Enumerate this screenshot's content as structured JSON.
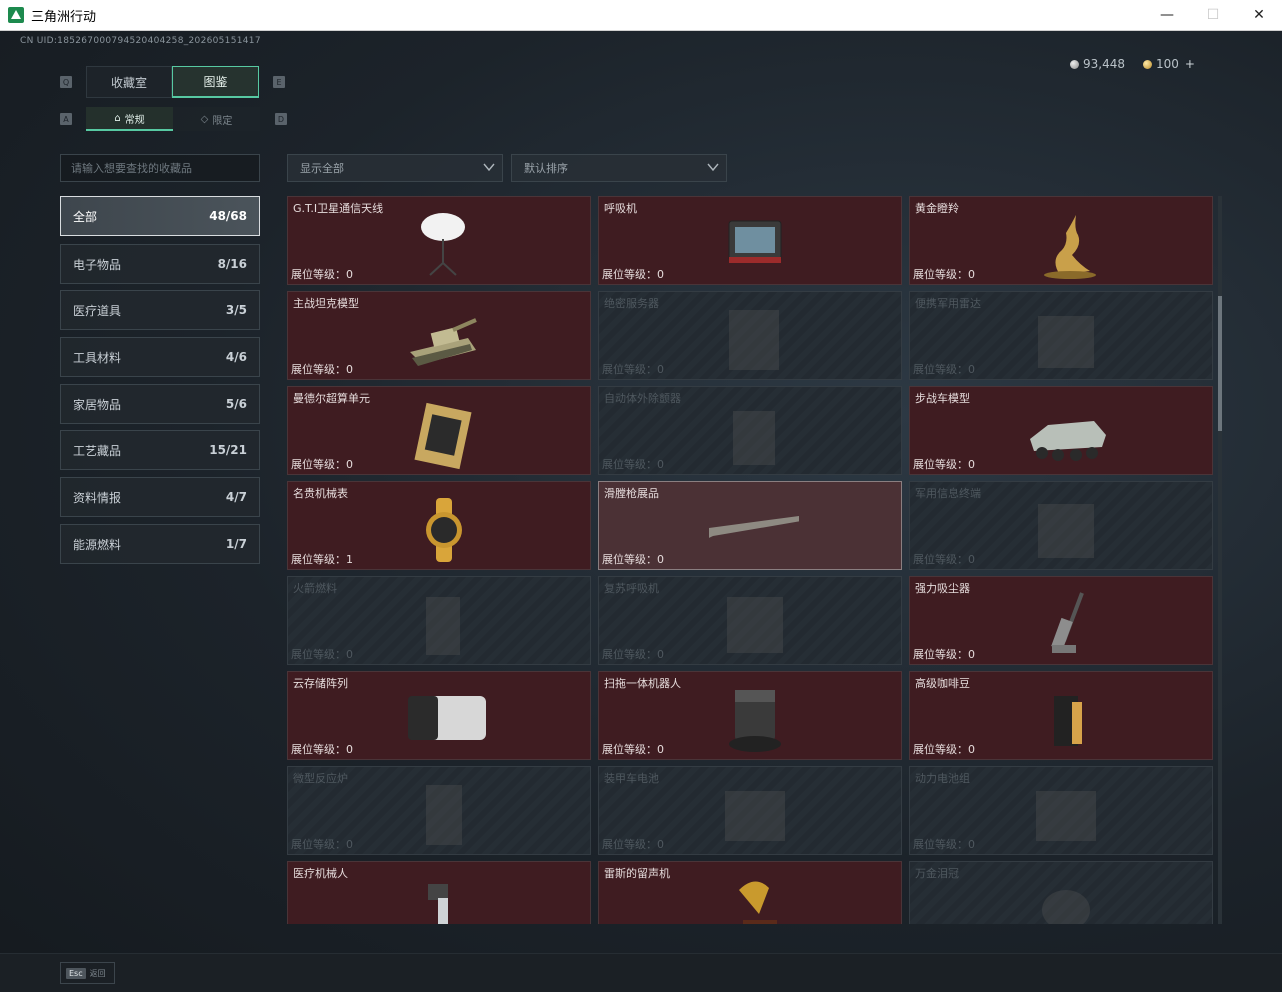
{
  "window": {
    "title": "三角洲行动",
    "minimize": "—",
    "maximize": "☐",
    "close": "✕"
  },
  "uid": "CN UID:185267000794520404258_202605151417",
  "currency": {
    "silver": "93,448",
    "gold": "100",
    "plus": "+"
  },
  "key_hints": {
    "q": "Q",
    "e": "E",
    "a": "A",
    "d": "D"
  },
  "tabs": [
    {
      "label": "收藏室"
    },
    {
      "label": "图鉴"
    }
  ],
  "subtabs": [
    {
      "label": "常规"
    },
    {
      "label": "限定"
    }
  ],
  "search": {
    "placeholder": "请输入想要查找的收藏品"
  },
  "filters": {
    "show": "显示全部",
    "sort": "默认排序"
  },
  "categories": [
    {
      "label": "全部",
      "count": "48/68"
    },
    {
      "label": "电子物品",
      "count": "8/16"
    },
    {
      "label": "医疗道具",
      "count": "3/5"
    },
    {
      "label": "工具材料",
      "count": "4/6"
    },
    {
      "label": "家居物品",
      "count": "5/6"
    },
    {
      "label": "工艺藏品",
      "count": "15/21"
    },
    {
      "label": "资料情报",
      "count": "4/7"
    },
    {
      "label": "能源燃料",
      "count": "1/7"
    }
  ],
  "level_prefix": "展位等级：",
  "items": [
    {
      "name": "G.T.I卫星通信天线",
      "level": "0",
      "icon": "satellite-dish-icon",
      "state": "owned"
    },
    {
      "name": "呼吸机",
      "level": "0",
      "icon": "ventilator-icon",
      "state": "owned"
    },
    {
      "name": "黄金瞪羚",
      "level": "0",
      "icon": "golden-gazelle-icon",
      "state": "owned"
    },
    {
      "name": "主战坦克模型",
      "level": "0",
      "icon": "tank-model-icon",
      "state": "owned"
    },
    {
      "name": "绝密服务器",
      "level": "0",
      "icon": "server-icon",
      "state": "locked"
    },
    {
      "name": "便携军用雷达",
      "level": "0",
      "icon": "radar-icon",
      "state": "locked"
    },
    {
      "name": "曼德尔超算单元",
      "level": "0",
      "icon": "compute-unit-icon",
      "state": "owned"
    },
    {
      "name": "自动体外除颤器",
      "level": "0",
      "icon": "defibrillator-icon",
      "state": "locked"
    },
    {
      "name": "步战车模型",
      "level": "0",
      "icon": "ifv-model-icon",
      "state": "owned"
    },
    {
      "name": "名贵机械表",
      "level": "1",
      "icon": "watch-icon",
      "state": "owned"
    },
    {
      "name": "滑膛枪展品",
      "level": "0",
      "icon": "musket-icon",
      "state": "highlight"
    },
    {
      "name": "军用信息终端",
      "level": "0",
      "icon": "terminal-icon",
      "state": "locked"
    },
    {
      "name": "火箭燃料",
      "level": "0",
      "icon": "rocket-fuel-icon",
      "state": "locked"
    },
    {
      "name": "复苏呼吸机",
      "level": "0",
      "icon": "resuscitator-icon",
      "state": "locked"
    },
    {
      "name": "强力吸尘器",
      "level": "0",
      "icon": "vacuum-icon",
      "state": "owned"
    },
    {
      "name": "云存储阵列",
      "level": "0",
      "icon": "storage-array-icon",
      "state": "owned"
    },
    {
      "name": "扫拖一体机器人",
      "level": "0",
      "icon": "robot-vacuum-icon",
      "state": "owned"
    },
    {
      "name": "高级咖啡豆",
      "level": "0",
      "icon": "coffee-bag-icon",
      "state": "owned"
    },
    {
      "name": "微型反应炉",
      "level": "0",
      "icon": "reactor-icon",
      "state": "locked"
    },
    {
      "name": "装甲车电池",
      "level": "0",
      "icon": "battery-icon",
      "state": "locked"
    },
    {
      "name": "动力电池组",
      "level": "0",
      "icon": "battery-pack-icon",
      "state": "locked"
    },
    {
      "name": "医疗机械人",
      "level": "",
      "icon": "medical-robot-icon",
      "state": "owned"
    },
    {
      "name": "雷斯的留声机",
      "level": "",
      "icon": "gramophone-icon",
      "state": "owned"
    },
    {
      "name": "万金泪冠",
      "level": "",
      "icon": "crown-icon",
      "state": "locked"
    }
  ],
  "footer": {
    "esc_key": "Esc",
    "esc_label": "返回"
  },
  "colors": {
    "accent": "#57c9a2",
    "owned_card": "#3f1c21",
    "locked_card": "#232a31"
  }
}
